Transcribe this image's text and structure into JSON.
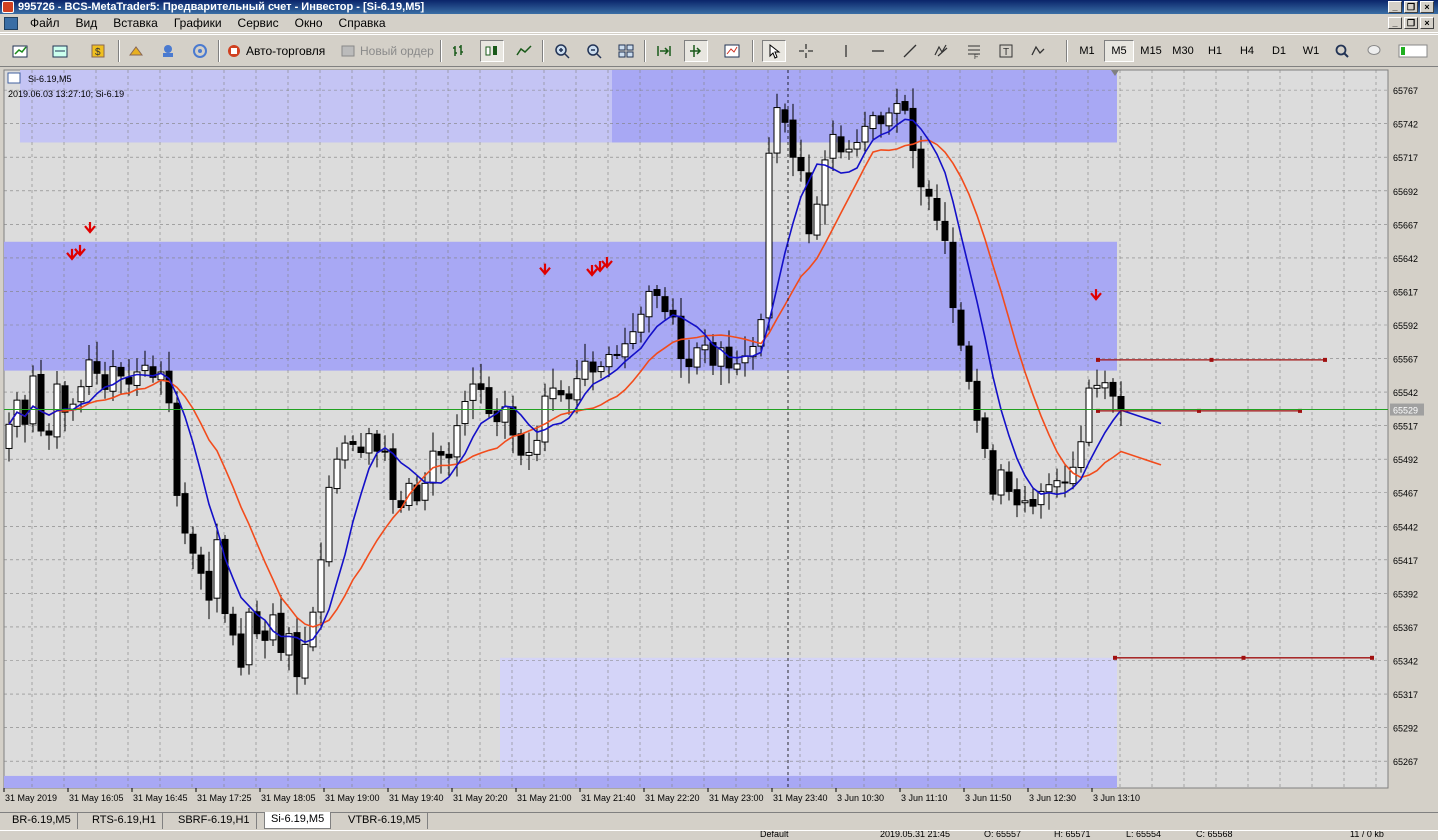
{
  "window": {
    "title": "995726 - BCS-MetaTrader5: Предварительный счет - Инвестор - [Si-6.19,M5]"
  },
  "menu": [
    "Файл",
    "Вид",
    "Вставка",
    "Графики",
    "Сервис",
    "Окно",
    "Справка"
  ],
  "toolbar": {
    "autotrade_label": "Авто-торговля",
    "new_order_label": "Новый ордер",
    "timeframes": [
      "M1",
      "M5",
      "M15",
      "M30",
      "H1",
      "H4",
      "D1",
      "W1"
    ],
    "active_timeframe": "M5",
    "icons": [
      "new-chart-icon",
      "profiles-icon",
      "market-watch-icon",
      "navigator-icon",
      "data-window-icon",
      "signals-icon",
      "bar-chart-icon",
      "candles-icon",
      "line-chart-icon",
      "zoom-in-icon",
      "zoom-out-icon",
      "tile-icon",
      "autoscroll-icon",
      "chart-shift-icon",
      "indicators-icon",
      "cursor-icon",
      "crosshair-icon",
      "vertical-line-icon",
      "horizontal-line-icon",
      "trendline-icon",
      "elliott-icon",
      "fibonacci-icon",
      "text-icon",
      "shapes-icon",
      "search-icon",
      "chat-icon",
      "connection-icon"
    ]
  },
  "chart": {
    "symbol_label": "Si-6.19,M5",
    "info_line": "2019.06.03 13:27:10; Si-6.19",
    "current_price": "65529",
    "colors": {
      "background": "#dcdcdc",
      "zone_band": "#a8a8f4",
      "zone_light": "#c4c4f4",
      "zone_low": "#d4d4f8",
      "bid_line": "#21a221",
      "ma_fast": "#1410c8",
      "ma_slow": "#f24c1c",
      "arrow": "#e00000",
      "level_line": "#a01010"
    }
  },
  "chart_data": {
    "type": "candlestick",
    "symbol": "Si-6.19",
    "timeframe": "M5",
    "y_ticks": [
      65767,
      65742,
      65717,
      65692,
      65667,
      65642,
      65617,
      65592,
      65567,
      65542,
      65517,
      65492,
      65467,
      65442,
      65417,
      65392,
      65367,
      65342,
      65317,
      65292,
      65267
    ],
    "ylim": [
      65247,
      65782
    ],
    "x_labels": [
      "31 May 2019",
      "31 May 16:05",
      "31 May 16:45",
      "31 May 17:25",
      "31 May 18:05",
      "31 May 19:00",
      "31 May 19:40",
      "31 May 20:20",
      "31 May 21:00",
      "31 May 21:40",
      "31 May 22:20",
      "31 May 23:00",
      "31 May 23:40",
      "3 Jun 10:30",
      "3 Jun 11:10",
      "3 Jun 11:50",
      "3 Jun 12:30",
      "3 Jun 13:10"
    ],
    "close_path": [
      65518,
      65536,
      65518,
      65554,
      65513,
      65510,
      65548,
      65527,
      65533,
      65546,
      65566,
      65556,
      65544,
      65561,
      65554,
      65548,
      65557,
      65562,
      65553,
      65557,
      65534,
      65465,
      65437,
      65422,
      65407,
      65387,
      65432,
      65377,
      65361,
      65337,
      65378,
      65362,
      65357,
      65376,
      65348,
      65362,
      65330,
      65354,
      65378,
      65417,
      65471,
      65492,
      65504,
      65503,
      65497,
      65511,
      65498,
      65498,
      65462,
      65456,
      65474,
      65461,
      65474,
      65498,
      65495,
      65493,
      65517,
      65535,
      65548,
      65544,
      65526,
      65520,
      65531,
      65510,
      65495,
      65497,
      65506,
      65539,
      65545,
      65540,
      65537,
      65552,
      65565,
      65557,
      65561,
      65570,
      65570,
      65578,
      65587,
      65600,
      65617,
      65614,
      65602,
      65598,
      65567,
      65561,
      65575,
      65577,
      65562,
      65575,
      65560,
      65563,
      65569,
      65576,
      65596,
      65720,
      65754,
      65743,
      65717,
      65707,
      65660,
      65682,
      65715,
      65734,
      65721,
      65723,
      65728,
      65740,
      65748,
      65742,
      65750,
      65757,
      65752,
      65722,
      65695,
      65688,
      65670,
      65655,
      65605,
      65577,
      65550,
      65521,
      65500,
      65466,
      65484,
      65468,
      65458,
      65461,
      65457,
      65468,
      65473,
      65476,
      65475,
      65486,
      65505,
      65545,
      65547,
      65549,
      65539,
      65529
    ],
    "levels": [
      65566,
      65528,
      65344
    ],
    "bid": 65529,
    "sell_arrows": 9
  },
  "tabs": [
    "BR-6.19,M5",
    "RTS-6.19,H1",
    "SBRF-6.19,H1",
    "Si-6.19,M5",
    "VTBR-6.19,M5"
  ],
  "active_tab": "Si-6.19,M5",
  "status": {
    "profile": "Default",
    "datetime": "2019.05.31 21:45",
    "open": "O: 65557",
    "high": "H: 65571",
    "low": "L: 65554",
    "close": "C: 65568",
    "traffic": "11 / 0 kb"
  }
}
